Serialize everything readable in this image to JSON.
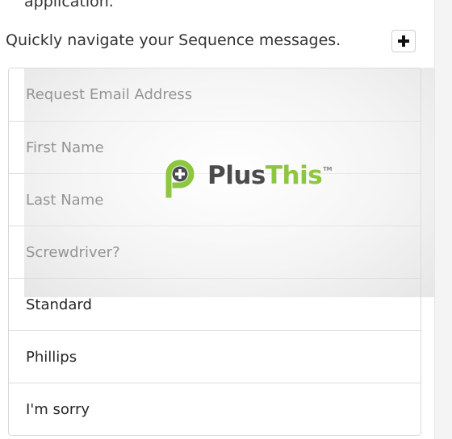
{
  "top_cutoff_text": "application.",
  "header": {
    "text": "Quickly navigate your Sequence messages.",
    "add_button_icon": "plus-icon"
  },
  "list": {
    "items": [
      {
        "label": "Request Email Address"
      },
      {
        "label": "First Name"
      },
      {
        "label": "Last Name"
      },
      {
        "label": "Screwdriver?"
      },
      {
        "label": "Standard"
      },
      {
        "label": "Phillips"
      },
      {
        "label": "I'm sorry"
      }
    ]
  },
  "watermark": {
    "logo_icon": "plusthis-logo-icon",
    "word_dark": "Plus",
    "word_green": "This",
    "trademark": "TM",
    "colors": {
      "dark": "#4b4b4b",
      "green": "#8dc63f"
    }
  }
}
